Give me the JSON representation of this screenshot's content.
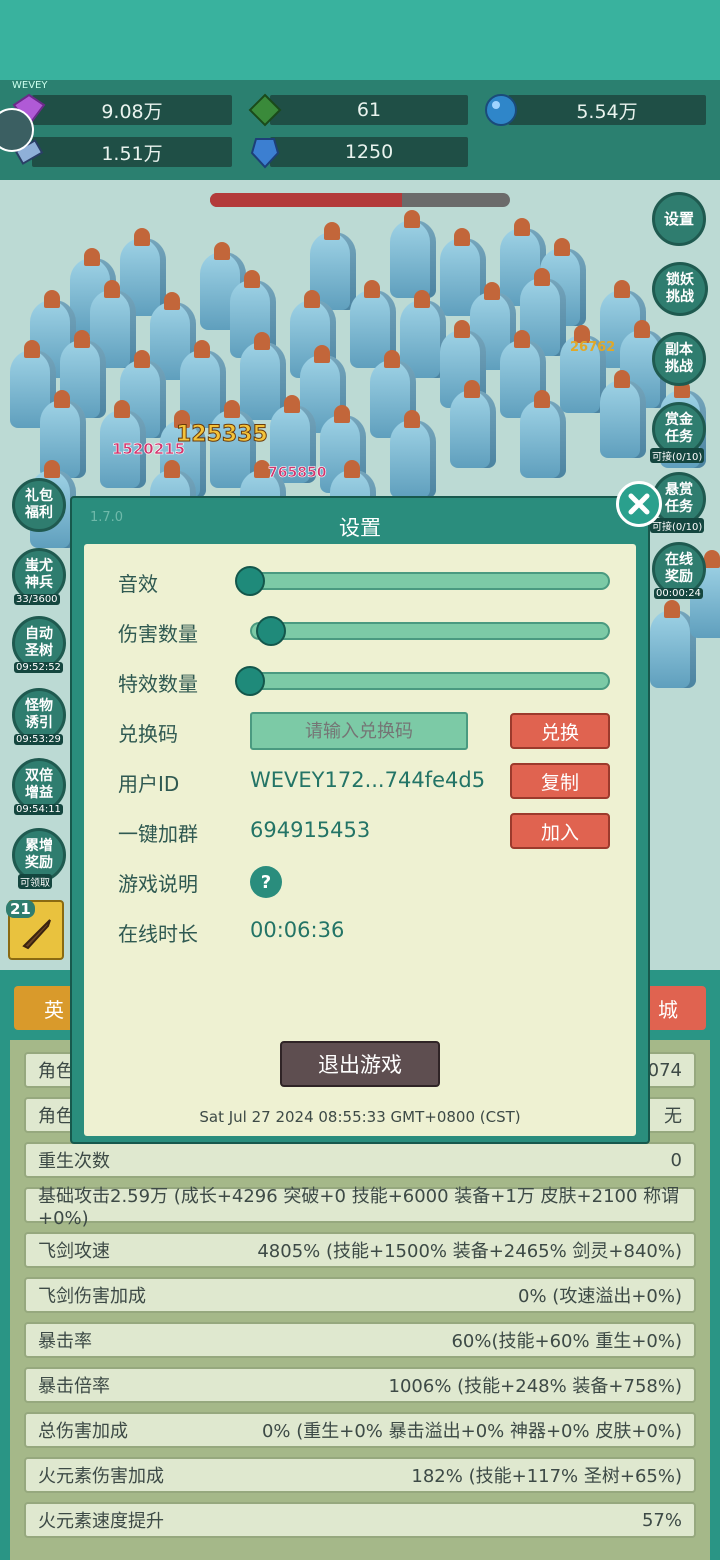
{
  "resources": [
    {
      "icon": "purple-gem-icon",
      "value": "9.08万"
    },
    {
      "icon": "green-gem-icon",
      "value": "61"
    },
    {
      "icon": "blue-orb-icon",
      "value": "5.54万"
    },
    {
      "icon": "scroll-icon",
      "value": "1.51万"
    },
    {
      "icon": "blue-crystal-icon",
      "value": "1250"
    }
  ],
  "player_tag": "WEVEY",
  "damage_numbers": [
    "125335",
    "1520215",
    "765850",
    "26762"
  ],
  "right_buttons": [
    {
      "label": "设置",
      "sub": ""
    },
    {
      "label": "锁妖挑战",
      "sub": ""
    },
    {
      "label": "副本挑战",
      "sub": ""
    },
    {
      "label": "赏金任务",
      "sub": "可接(0/10)"
    },
    {
      "label": "悬赏任务",
      "sub": "可接(0/10)"
    },
    {
      "label": "在线奖励",
      "sub": "00:00:24"
    }
  ],
  "left_buttons": [
    {
      "label": "礼包福利",
      "sub": ""
    },
    {
      "label": "蚩尤神兵",
      "sub": "33/3600"
    },
    {
      "label": "自动圣树",
      "sub": "09:52:52"
    },
    {
      "label": "怪物诱引",
      "sub": "09:53:29"
    },
    {
      "label": "双倍增益",
      "sub": "09:54:11"
    },
    {
      "label": "累增奖励",
      "sub": "可领取"
    }
  ],
  "hero_level": "21",
  "tabs": {
    "left": "英",
    "right": "城"
  },
  "partial_values": [
    "074",
    "无"
  ],
  "stats": [
    {
      "label": "角色",
      "value": "074"
    },
    {
      "label": "角色",
      "value": "无"
    },
    {
      "label": "重生次数",
      "value": "0"
    },
    {
      "label": "基础攻击2.59万 (成长+4296 突破+0 技能+6000 装备+1万 皮肤+2100 称谓+0%)",
      "value": ""
    },
    {
      "label": "飞剑攻速",
      "value": "4805% (技能+1500% 装备+2465% 剑灵+840%)"
    },
    {
      "label": "飞剑伤害加成",
      "value": "0% (攻速溢出+0%)"
    },
    {
      "label": "暴击率",
      "value": "60%(技能+60% 重生+0%)"
    },
    {
      "label": "暴击倍率",
      "value": "1006% (技能+248% 装备+758%)"
    },
    {
      "label": "总伤害加成",
      "value": "0% (重生+0% 暴击溢出+0% 神器+0% 皮肤+0%)"
    },
    {
      "label": "火元素伤害加成",
      "value": "182% (技能+117% 圣树+65%)"
    },
    {
      "label": "火元素速度提升",
      "value": "57%"
    }
  ],
  "settings": {
    "version": "1.7.0",
    "title": "设置",
    "sound_label": "音效",
    "sound_level": 0,
    "damage_label": "伤害数量",
    "damage_level": 0,
    "effect_label": "特效数量",
    "effect_level": 0,
    "code_label": "兑换码",
    "code_placeholder": "请输入兑换码",
    "redeem_button": "兑换",
    "userid_label": "用户ID",
    "userid_value": "WEVEY172...744fe4d5",
    "copy_button": "复制",
    "group_label": "一键加群",
    "group_value": "694915453",
    "join_button": "加入",
    "help_label": "游戏说明",
    "help_symbol": "?",
    "online_label": "在线时长",
    "online_value": "00:06:36",
    "exit_button": "退出游戏",
    "datetime": "Sat Jul 27 2024 08:55:33 GMT+0800 (CST)"
  },
  "colors": {
    "accent": "#2a8d7d",
    "danger": "#e06350",
    "panel": "#eef1d2"
  },
  "boss_hp_fraction": 0.64
}
